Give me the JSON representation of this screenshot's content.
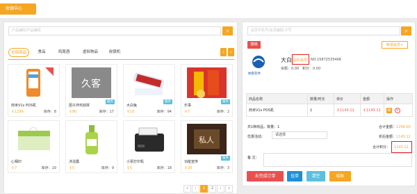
{
  "header": {
    "title": "收银中心"
  },
  "products": {
    "search_placeholder": "产品编码/产品编码",
    "tabs": [
      "全部商品",
      "食品",
      "鸡尾酒",
      "虚拟物品",
      "收银机"
    ],
    "items": [
      {
        "name": "商米V1s POS机",
        "price": "￥1299",
        "stock": "库存：8",
        "badge": ""
      },
      {
        "name": "团子炸鸡双拼",
        "price": "￥80",
        "stock": "库存：17",
        "badge": "服务"
      },
      {
        "name": "大白兔",
        "price": "￥10",
        "stock": "库存：94",
        "badge": "服务"
      },
      {
        "name": "乐事",
        "price": "￥7",
        "stock": "库存：2",
        "badge": "服务"
      },
      {
        "name": "心相印",
        "price": "￥7",
        "stock": "库存：19",
        "badge": ""
      },
      {
        "name": "沐浴露",
        "price": "￥5",
        "stock": "库存：9",
        "badge": ""
      },
      {
        "name": "小票打印机",
        "price": "￥5",
        "stock": "库存：18",
        "badge": ""
      },
      {
        "name": "功能宣传",
        "price": "￥20",
        "stock": "库存：3",
        "badge": "服务"
      }
    ],
    "pager": [
      "«",
      "‹",
      "1",
      "2",
      "›",
      "»"
    ]
  },
  "member": {
    "search_placeholder": "会员手机号/会员编码/卡号",
    "clear_label": "撤销",
    "new_member_label": "新增会员",
    "name": "大白",
    "level": "钻石会员",
    "no": "NO.15872535466",
    "balance": "余额：0.00",
    "points": "积分：0.00",
    "logo_text": "纳客软件"
  },
  "cart": {
    "headers": [
      "商品名称",
      "数量/时长",
      "单价",
      "金额",
      "操作"
    ],
    "rows": [
      {
        "name": "商米V1s POS机",
        "qty": "1",
        "price": "￥1143.12",
        "amount": "￥1143.12"
      }
    ]
  },
  "summary": {
    "count_line": "共1种商品，数量：1",
    "total_label": "合计金额：",
    "total": "1299.00",
    "discount_label": "折后金额：",
    "discount": "1143.12",
    "points_label": "合计积分：",
    "points": "1143.12",
    "promo_label": "优惠活动：",
    "promo_value": "请选择",
    "remark_label": "备    注："
  },
  "actions": {
    "pending": "未完成订单",
    "hang": "挂单",
    "clear": "清空",
    "settle": "结账"
  },
  "colors": {
    "accent": "#f5a623",
    "danger": "#e8504e",
    "info": "#5bc0de"
  }
}
